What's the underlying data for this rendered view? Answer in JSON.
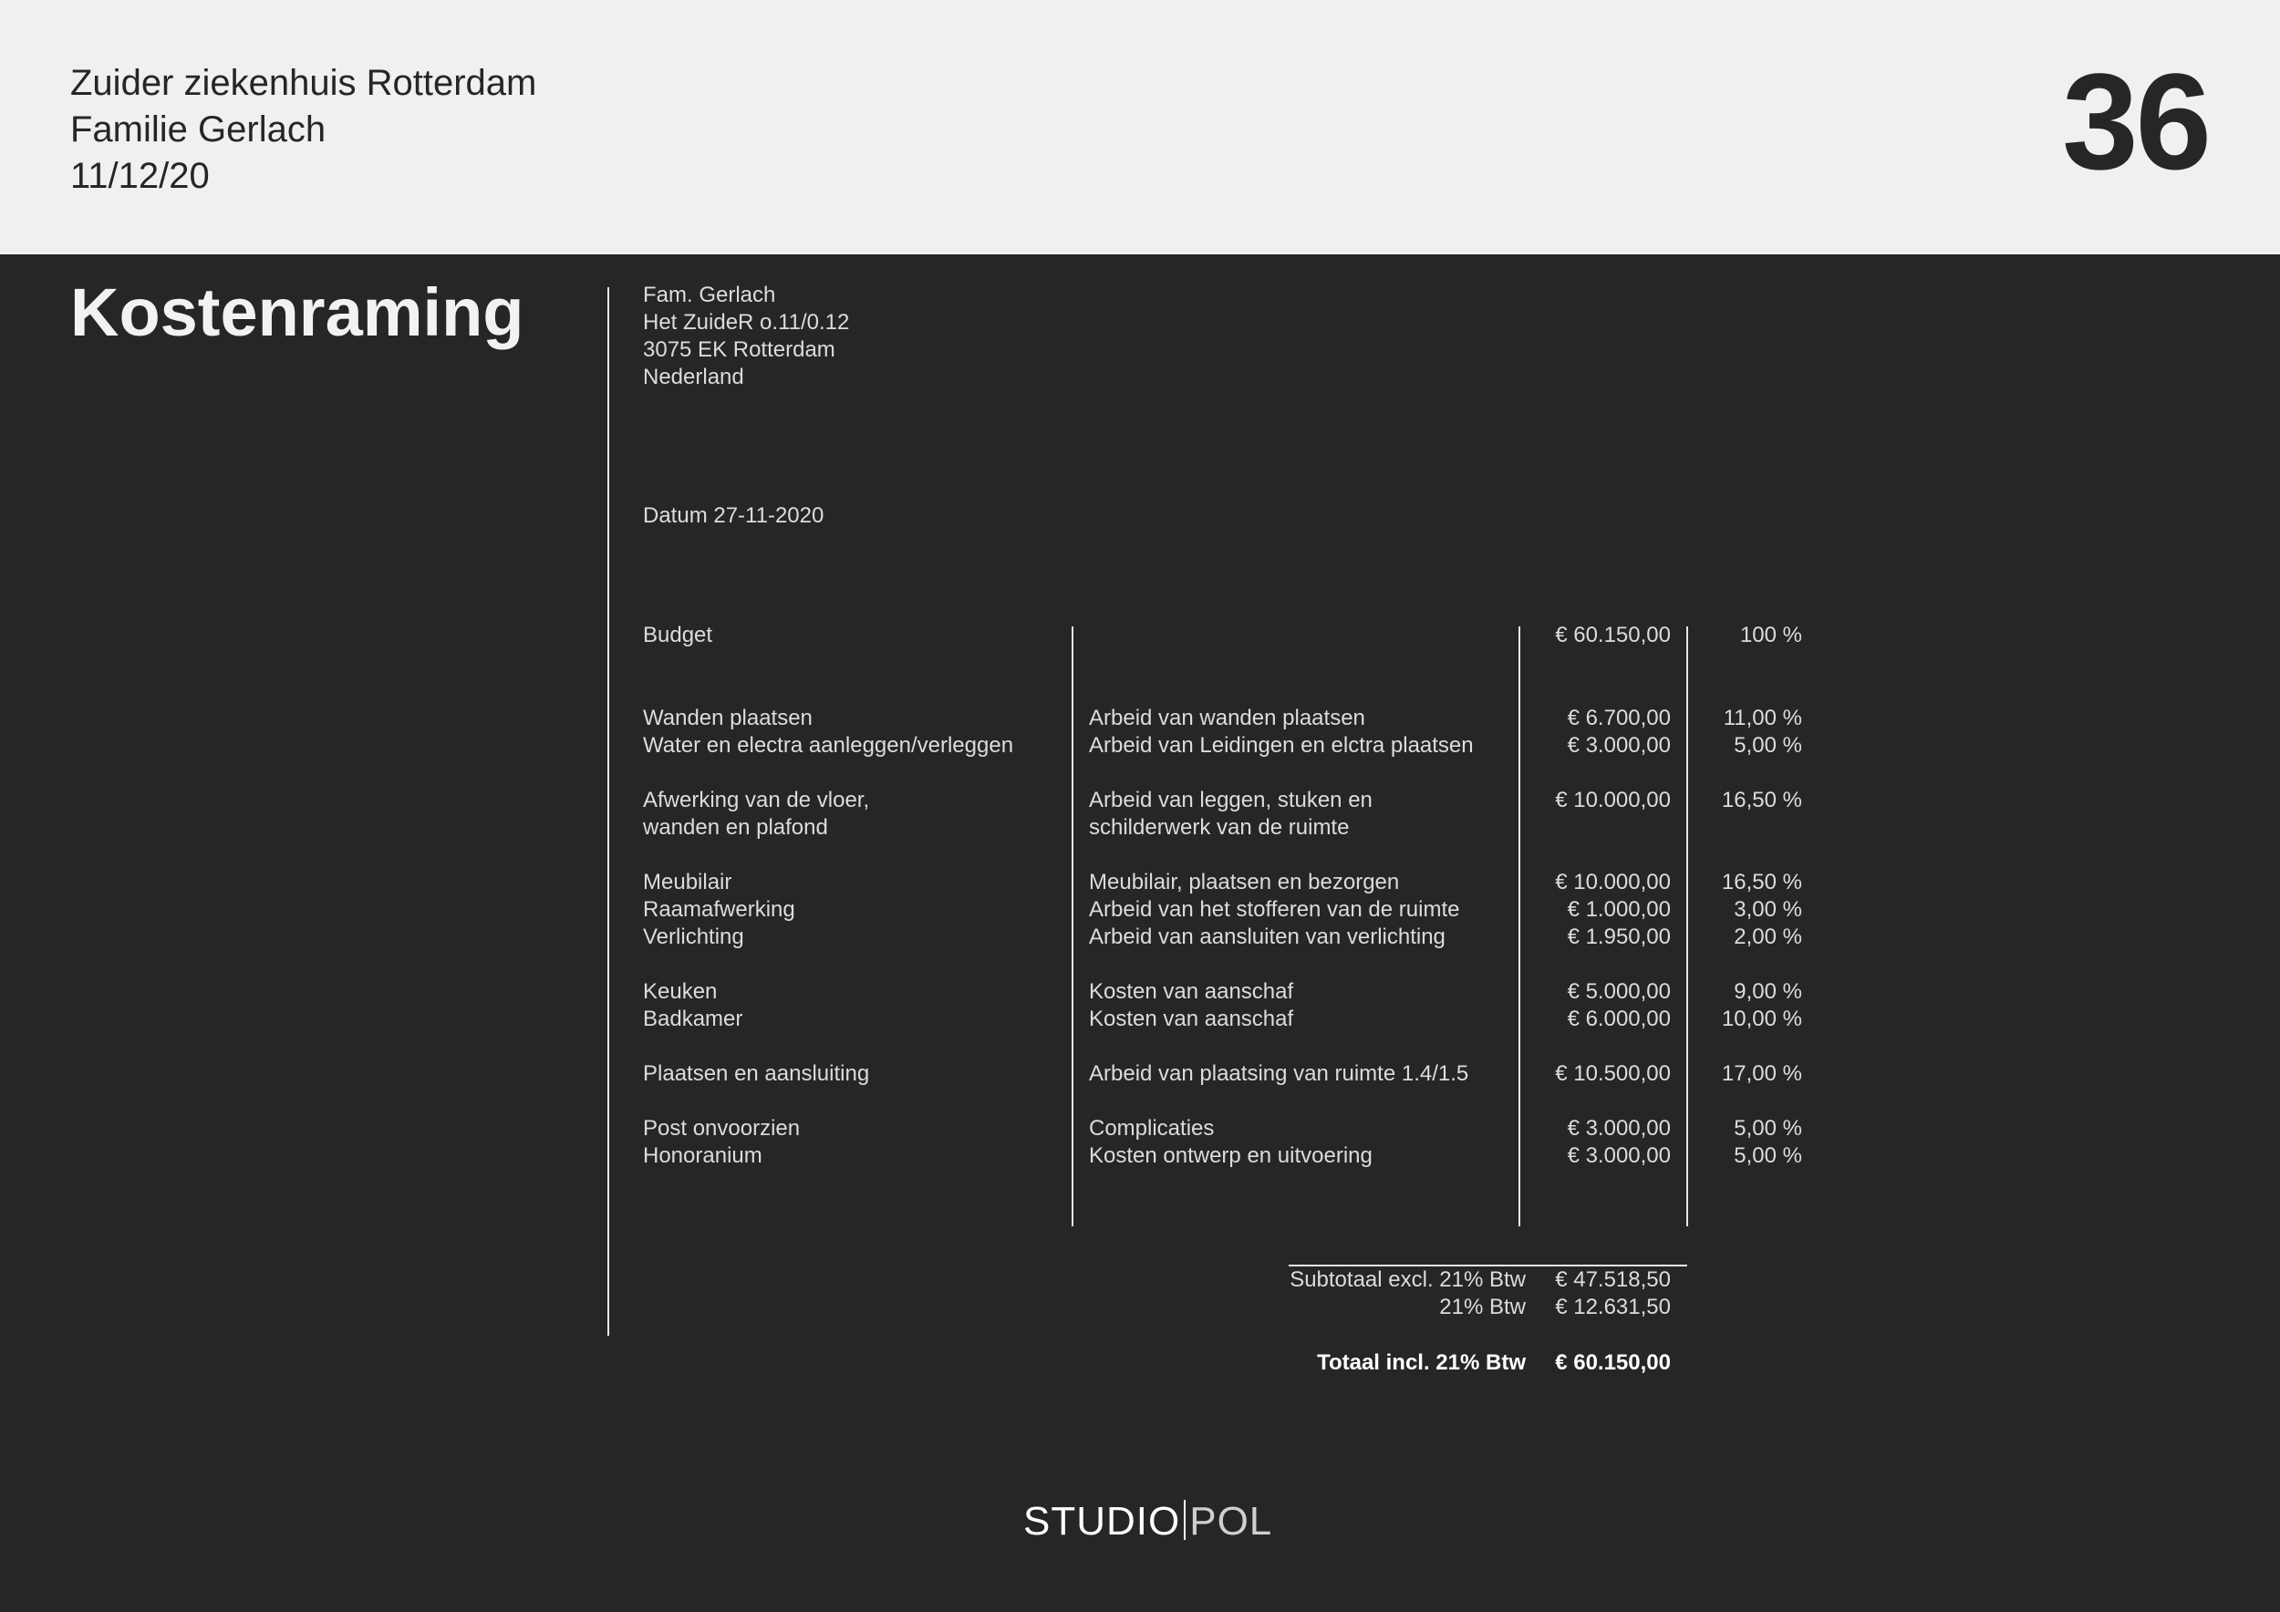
{
  "header": {
    "line1": "Zuider ziekenhuis Rotterdam",
    "line2": "Familie Gerlach",
    "line3": "11/12/20",
    "page_number": "36"
  },
  "title": "Kostenraming",
  "address": {
    "name": "Fam. Gerlach",
    "street": "Het ZuideR o.11/0.12",
    "city": "3075 EK Rotterdam",
    "country": "Nederland"
  },
  "date": "Datum 27-11-2020",
  "budget": {
    "label": "Budget",
    "amount": "€ 60.150,00",
    "percent": "100 %"
  },
  "rows": [
    {
      "item": "Wanden plaatsen",
      "description": "Arbeid van wanden plaatsen",
      "amount": "€ 6.700,00",
      "percent": "11,00 %"
    },
    {
      "item": "Water en electra aanleggen/verleggen",
      "description": "Arbeid van Leidingen en elctra plaatsen",
      "amount": "€ 3.000,00",
      "percent": "5,00 %"
    },
    {
      "item": "Afwerking van de vloer,",
      "item2": "wanden en plafond",
      "description": "Arbeid van leggen, stuken en",
      "description2": "schilderwerk van de ruimte",
      "amount": "€ 10.000,00",
      "percent": "16,50 %"
    },
    {
      "item": "Meubilair",
      "description": "Meubilair, plaatsen en bezorgen",
      "amount": "€ 10.000,00",
      "percent": "16,50 %"
    },
    {
      "item": "Raamafwerking",
      "description": "Arbeid van het stofferen van de ruimte",
      "amount": "€ 1.000,00",
      "percent": "3,00 %"
    },
    {
      "item": "Verlichting",
      "description": "Arbeid van aansluiten van verlichting",
      "amount": "€ 1.950,00",
      "percent": "2,00 %"
    },
    {
      "item": "Keuken",
      "description": "Kosten van aanschaf",
      "amount": "€ 5.000,00",
      "percent": "9,00 %"
    },
    {
      "item": "Badkamer",
      "description": "Kosten van aanschaf",
      "amount": "€ 6.000,00",
      "percent": "10,00 %"
    },
    {
      "item": "Plaatsen en aansluiting",
      "description": "Arbeid van plaatsing van ruimte 1.4/1.5",
      "amount": "€ 10.500,00",
      "percent": "17,00 %"
    },
    {
      "item": "Post onvoorzien",
      "description": "Complicaties",
      "amount": "€ 3.000,00",
      "percent": "5,00 %"
    },
    {
      "item": "Honoranium",
      "description": "Kosten ontwerp en uitvoering",
      "amount": "€ 3.000,00",
      "percent": "5,00 %"
    }
  ],
  "totals": {
    "subtotal_label": "Subtotaal excl. 21% Btw",
    "subtotal_amount": "€ 47.518,50",
    "vat_label": "21% Btw",
    "vat_amount": "€ 12.631,50",
    "total_label": "Totaal incl. 21% Btw",
    "total_amount": "€ 60.150,00"
  },
  "logo": {
    "part1": "STUDIO",
    "part2": "POL"
  }
}
